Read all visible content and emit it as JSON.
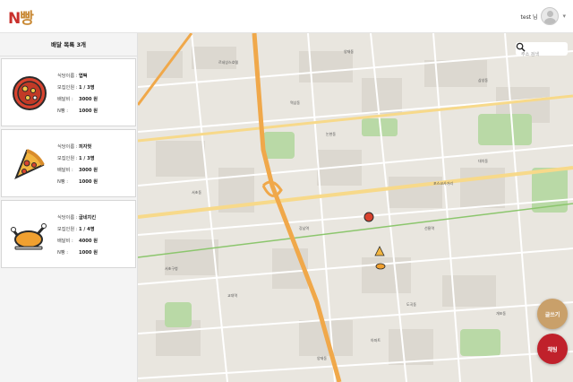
{
  "header": {
    "logo_n": "N",
    "logo_rest": "빵",
    "user_name": "test 님",
    "chevron": "▾"
  },
  "sidebar": {
    "title": "배달 목록 3개",
    "labels": {
      "restaurant": "식당이름 :",
      "members": "모집인원 :",
      "delivery_fee": "배달비 :",
      "n_split": "N빵 :"
    },
    "cards": [
      {
        "icon": "pizza-plate-icon",
        "restaurant": "엽떡",
        "members": "1 / 3명",
        "delivery_fee": "3000 원",
        "n_split": "1000 원"
      },
      {
        "icon": "pizza-slice-icon",
        "restaurant": "피자헛",
        "members": "1 / 3명",
        "delivery_fee": "3000 원",
        "n_split": "1000 원"
      },
      {
        "icon": "roast-chicken-icon",
        "restaurant": "굽네치킨",
        "members": "1 / 4명",
        "delivery_fee": "4000 원",
        "n_split": "1000 원"
      }
    ]
  },
  "map": {
    "search_placeholder": "주소 검색",
    "write_button": "글쓰기",
    "chat_button": "채팅",
    "labels": [
      "역삼동",
      "서초동",
      "대치동",
      "삼성동",
      "논현동",
      "서초구청",
      "강남역",
      "선릉역",
      "도곡동",
      "개포동",
      "양재동",
      "한티역",
      "교대역",
      "포스코사거리",
      "아파트",
      "르네상스호텔"
    ],
    "colors": {
      "base": "#e9e6df",
      "highway": "#f0a84a",
      "road": "#ffffff",
      "park": "#b9d9a6",
      "block": "#d9d6cf"
    }
  }
}
